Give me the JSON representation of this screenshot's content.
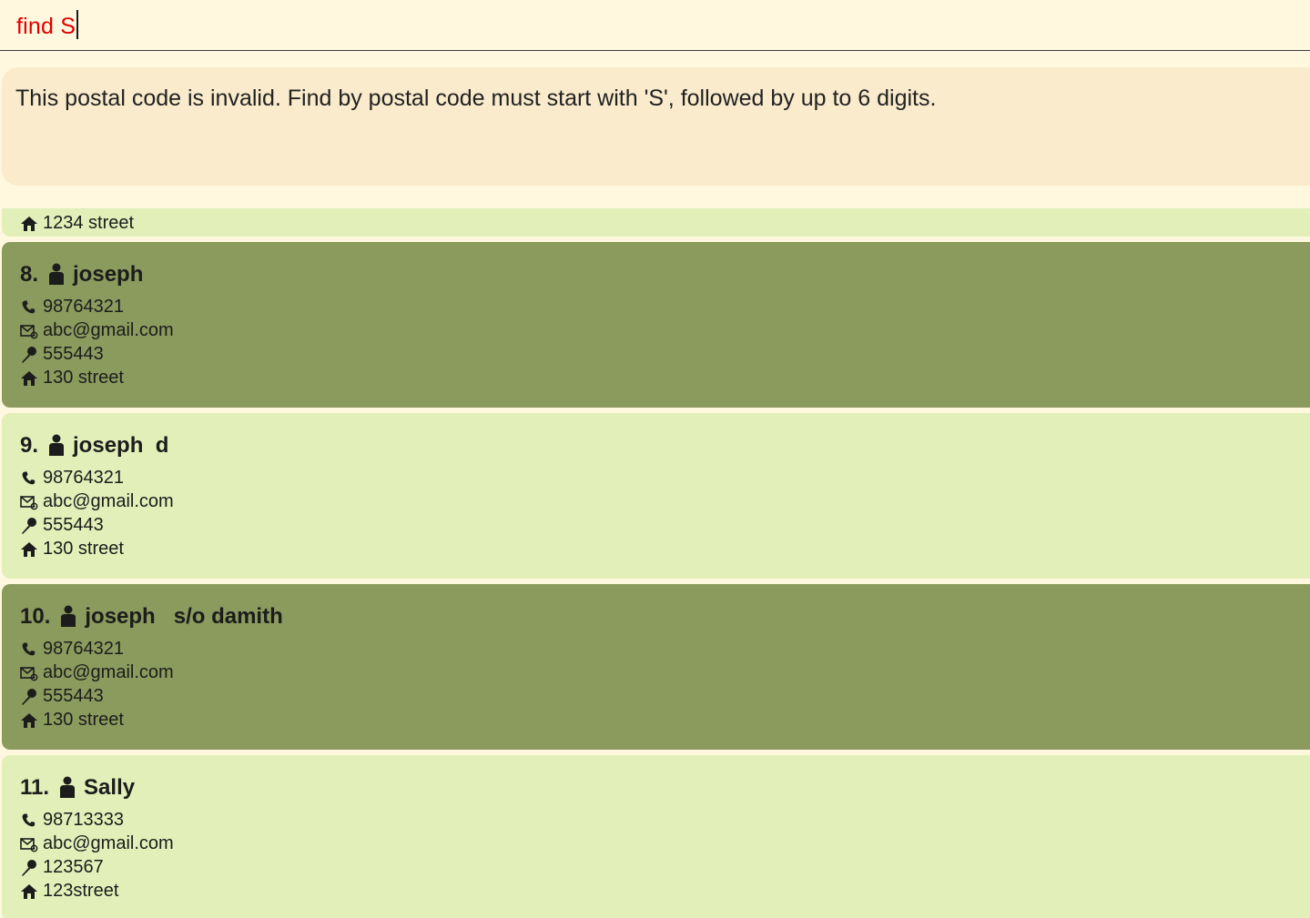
{
  "command": {
    "input_value": "find S"
  },
  "result": {
    "message": "This postal code is invalid. Find by postal code must start with 'S', followed by up to 6 digits."
  },
  "partial_card": {
    "address": "1234 street"
  },
  "persons": [
    {
      "index": "8.",
      "name": "joseph",
      "phone": "98764321",
      "email": "abc@gmail.com",
      "postal": "555443",
      "address": "130 street"
    },
    {
      "index": "9.",
      "name": "joseph  d",
      "phone": "98764321",
      "email": "abc@gmail.com",
      "postal": "555443",
      "address": "130 street"
    },
    {
      "index": "10.",
      "name": "joseph   s/o damith",
      "phone": "98764321",
      "email": "abc@gmail.com",
      "postal": "555443",
      "address": "130 street"
    },
    {
      "index": "11.",
      "name": "Sally",
      "phone": "98713333",
      "email": "abc@gmail.com",
      "postal": "123567",
      "address": "123street"
    }
  ],
  "icons": {
    "person": "person-icon",
    "phone": "phone-icon",
    "email": "email-icon",
    "postal": "pin-icon",
    "address": "home-icon"
  },
  "colors": {
    "background": "#fff8df",
    "command_text": "#e00000",
    "result_background": "#f9ebcc",
    "card_light": "#e2efb9",
    "card_dark": "#8b9a5d"
  }
}
